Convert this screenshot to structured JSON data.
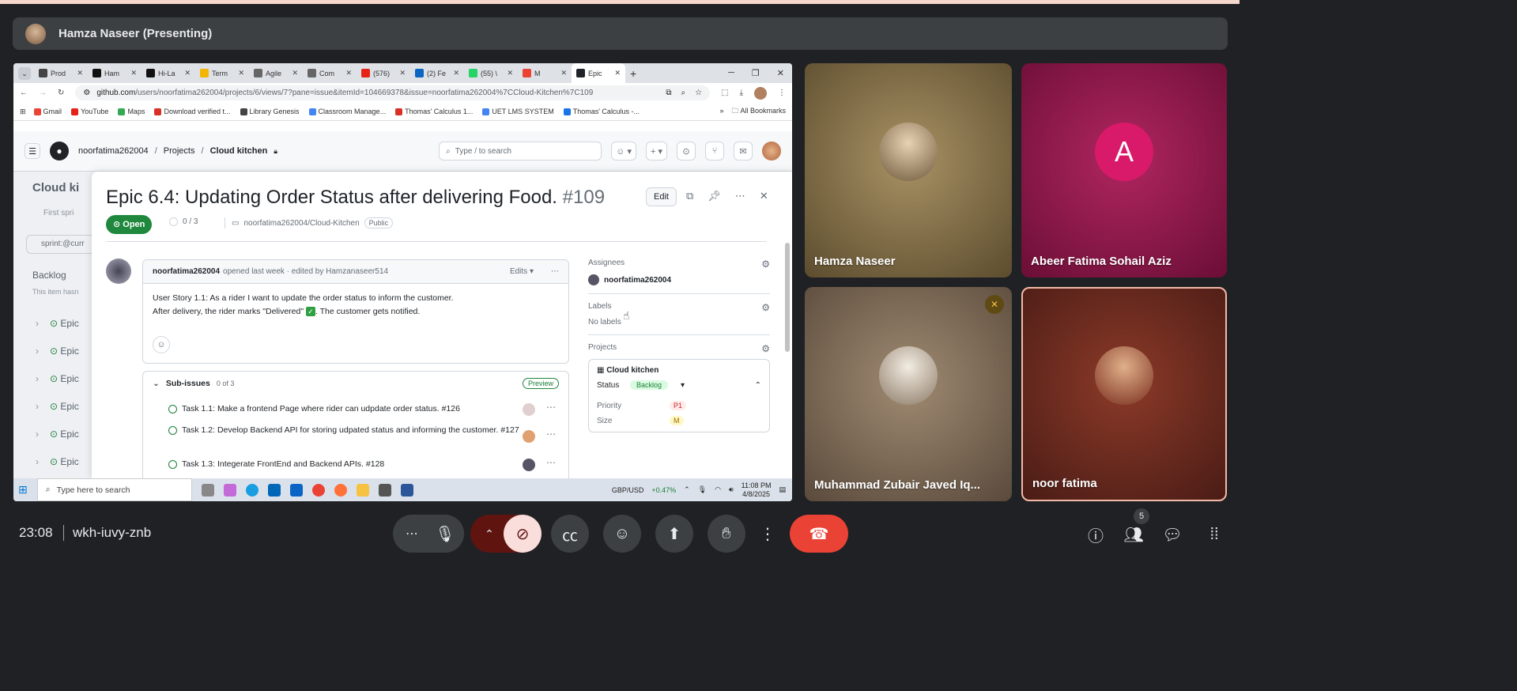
{
  "meet": {
    "presenter_label": "Hamza Naseer (Presenting)",
    "time": "23:08",
    "meeting_code": "wkh-iuvy-znb",
    "participants_count": "5"
  },
  "browser": {
    "tabs": [
      {
        "label": "Prod",
        "color": "#444"
      },
      {
        "label": "Ham",
        "color": "#111"
      },
      {
        "label": "Hi-La",
        "color": "#111"
      },
      {
        "label": "Term",
        "color": "#f4b400"
      },
      {
        "label": "Agile",
        "color": "#666"
      },
      {
        "label": "Com",
        "color": "#666"
      },
      {
        "label": "(576)",
        "color": "#e62117"
      },
      {
        "label": "(2) Fe",
        "color": "#0a66c2"
      },
      {
        "label": "(55) \\",
        "color": "#25d366"
      },
      {
        "label": "M",
        "color": "#ea4335"
      },
      {
        "label": "Epic",
        "color": "#1f2328"
      }
    ],
    "url_host": "github.com",
    "url_path": "/users/noorfatima262004/projects/6/views/7?pane=issue&itemId=104669378&issue=noorfatima262004%7CCloud-Kitchen%7C109",
    "bookmarks": [
      {
        "label": "Gmail",
        "color": "#ea4335"
      },
      {
        "label": "YouTube",
        "color": "#e62117"
      },
      {
        "label": "Maps",
        "color": "#34a853"
      },
      {
        "label": "Download verified t...",
        "color": "#d93025"
      },
      {
        "label": "Library Genesis",
        "color": "#444"
      },
      {
        "label": "Classroom Manage...",
        "color": "#4285f4"
      },
      {
        "label": "Thomas' Calculus 1...",
        "color": "#d93025"
      },
      {
        "label": "UET LMS SYSTEM",
        "color": "#4285f4"
      },
      {
        "label": "Thomas' Calculus -...",
        "color": "#1a73e8"
      }
    ],
    "all_bookmarks": "All Bookmarks"
  },
  "github": {
    "owner": "noorfatima262004",
    "projects": "Projects",
    "project": "Cloud kitchen",
    "search_placeholder": "Type / to search",
    "bg_title": "Cloud ki",
    "bg_sprint": "First spri",
    "bg_filter": "sprint:@curr",
    "bg_backlog": "Backlog",
    "bg_note": "This item hasn",
    "bg_rows": [
      "Epic",
      "Epic",
      "Epic",
      "Epic",
      "Epic",
      "Epic"
    ],
    "issue": {
      "title": "Epic 6.4: Updating Order Status after delivering Food.",
      "number": "#109",
      "edit": "Edit",
      "state": "Open",
      "progress": "0 / 3",
      "repo": "noorfatima262004/Cloud-Kitchen",
      "visibility": "Public",
      "author": "noorfatima262004",
      "meta": "opened last week · edited by Hamzanaseer514",
      "edits": "Edits",
      "body_line1": "User Story 1.1: As a rider I want to update the order status to inform the customer.",
      "body_line2a": "After delivery, the rider marks \"Delivered\"",
      "body_line2b": ". The customer gets notified.",
      "sub_title": "Sub-issues",
      "sub_count": "0 of 3",
      "preview": "Preview",
      "tasks": [
        "Task 1.1: Make a frontend Page where rider can udpdate order status. #126",
        "Task 1.2: Develop Backend API for storing udpated status and informing the customer. #127",
        "Task 1.3: Integerate FrontEnd and Backend APIs. #128"
      ]
    },
    "sidebar": {
      "assignees_label": "Assignees",
      "assignee": "noorfatima262004",
      "labels_label": "Labels",
      "labels_value": "No labels",
      "projects_label": "Projects",
      "project_name": "Cloud kitchen",
      "status_label": "Status",
      "status_value": "Backlog",
      "priority_label": "Priority",
      "priority_value": "P1",
      "size_label": "Size",
      "size_value": "M"
    }
  },
  "taskbar": {
    "search_placeholder": "Type here to search",
    "ticker": "GBP/USD",
    "ticker_change": "+0.47%",
    "time": "11:08 PM",
    "date": "4/8/2025"
  },
  "participants": [
    {
      "name": "Hamza Naseer"
    },
    {
      "name": "Abeer Fatima Sohail Aziz",
      "initial": "A"
    },
    {
      "name": "Muhammad Zubair Javed Iq..."
    },
    {
      "name": "noor fatima"
    }
  ]
}
